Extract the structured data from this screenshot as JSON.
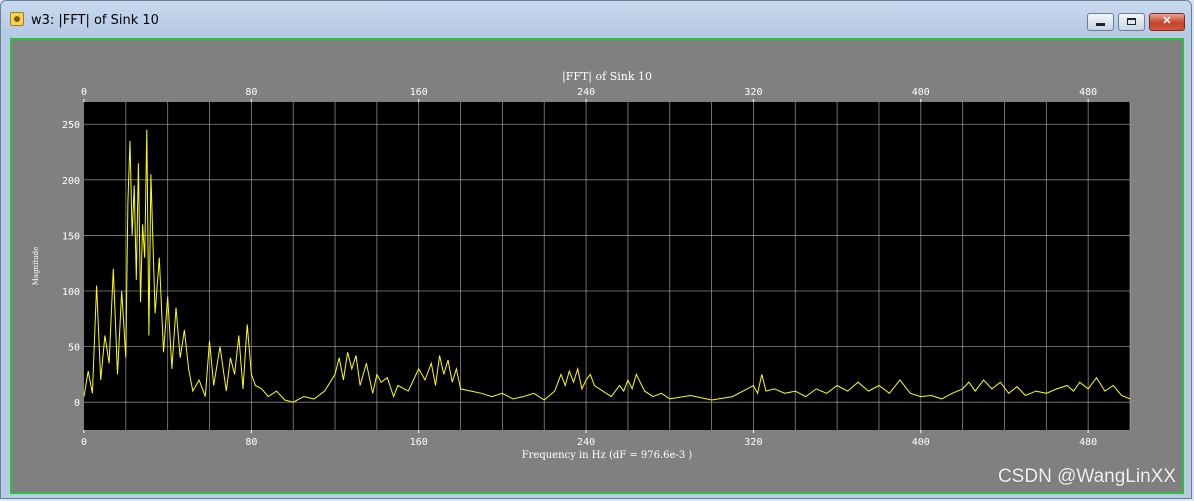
{
  "window": {
    "title": "w3: |FFT| of Sink 10",
    "controls": {
      "minimize_icon": "minimize-icon",
      "maximize_icon": "maximize-icon",
      "close_icon": "close-icon"
    }
  },
  "watermark": "CSDN @WangLinXX",
  "colors": {
    "plot_bg": "#000000",
    "frame_bg": "#808080",
    "grid": "#b4b4b4",
    "trace": "#ffff00",
    "tick_text": "#ffffff",
    "border_accent": "#2fbf3b"
  },
  "chart_data": {
    "type": "line",
    "title": "|FFT| of Sink 10",
    "xlabel": "Frequency in Hz (dF = 976.6e-3 )",
    "ylabel": "Magnitude",
    "xlim": [
      0,
      500
    ],
    "ylim": [
      -25,
      270
    ],
    "grid": true,
    "x_ticks_labeled": [
      0,
      80,
      160,
      240,
      320,
      400,
      480
    ],
    "x_tick_labels": [
      "0",
      "80",
      "160",
      "240",
      "320",
      "400",
      "480"
    ],
    "x_grid_step": 20,
    "y_ticks": [
      0,
      50,
      100,
      150,
      200,
      250
    ],
    "y_tick_labels": [
      "0",
      "50",
      "100",
      "150",
      "200",
      "250"
    ],
    "series": [
      {
        "color": "#ffff00",
        "x": [
          0,
          2,
          4,
          6,
          8,
          10,
          12,
          14,
          16,
          18,
          20,
          21,
          22,
          23,
          24,
          25,
          26,
          27,
          28,
          29,
          30,
          31,
          32,
          34,
          36,
          38,
          40,
          42,
          44,
          46,
          48,
          50,
          52,
          55,
          58,
          60,
          62,
          65,
          68,
          70,
          72,
          74,
          76,
          78,
          80,
          82,
          85,
          88,
          92,
          96,
          100,
          105,
          110,
          115,
          120,
          122,
          124,
          126,
          128,
          130,
          132,
          135,
          138,
          140,
          142,
          145,
          148,
          150,
          155,
          160,
          163,
          166,
          168,
          170,
          172,
          174,
          176,
          178,
          180,
          185,
          190,
          195,
          200,
          205,
          210,
          215,
          220,
          225,
          228,
          230,
          232,
          234,
          236,
          238,
          240,
          242,
          244,
          248,
          252,
          256,
          258,
          260,
          262,
          264,
          268,
          272,
          276,
          280,
          290,
          300,
          310,
          315,
          320,
          322,
          324,
          326,
          330,
          335,
          340,
          345,
          350,
          355,
          360,
          365,
          370,
          375,
          380,
          385,
          390,
          395,
          400,
          405,
          410,
          415,
          420,
          423,
          426,
          430,
          434,
          438,
          442,
          446,
          450,
          455,
          460,
          465,
          470,
          473,
          476,
          480,
          484,
          488,
          492,
          496,
          500
        ],
        "y": [
          5,
          28,
          8,
          105,
          20,
          60,
          35,
          120,
          25,
          100,
          40,
          180,
          235,
          150,
          195,
          110,
          215,
          90,
          160,
          130,
          245,
          60,
          205,
          80,
          130,
          45,
          95,
          30,
          85,
          40,
          65,
          30,
          10,
          20,
          5,
          55,
          15,
          50,
          10,
          40,
          25,
          60,
          12,
          70,
          25,
          15,
          12,
          5,
          10,
          2,
          0,
          5,
          3,
          10,
          25,
          40,
          20,
          45,
          30,
          42,
          15,
          35,
          8,
          25,
          18,
          22,
          5,
          15,
          10,
          30,
          20,
          35,
          15,
          42,
          25,
          38,
          18,
          30,
          12,
          10,
          8,
          5,
          8,
          3,
          5,
          8,
          2,
          10,
          25,
          15,
          28,
          18,
          30,
          12,
          20,
          25,
          15,
          10,
          5,
          15,
          10,
          20,
          12,
          25,
          10,
          5,
          8,
          3,
          6,
          2,
          5,
          10,
          15,
          8,
          25,
          10,
          12,
          8,
          10,
          5,
          12,
          8,
          15,
          10,
          18,
          10,
          15,
          8,
          20,
          8,
          5,
          6,
          3,
          8,
          12,
          18,
          10,
          20,
          12,
          18,
          8,
          14,
          6,
          10,
          8,
          12,
          15,
          10,
          18,
          12,
          22,
          10,
          15,
          6,
          3
        ]
      }
    ]
  }
}
